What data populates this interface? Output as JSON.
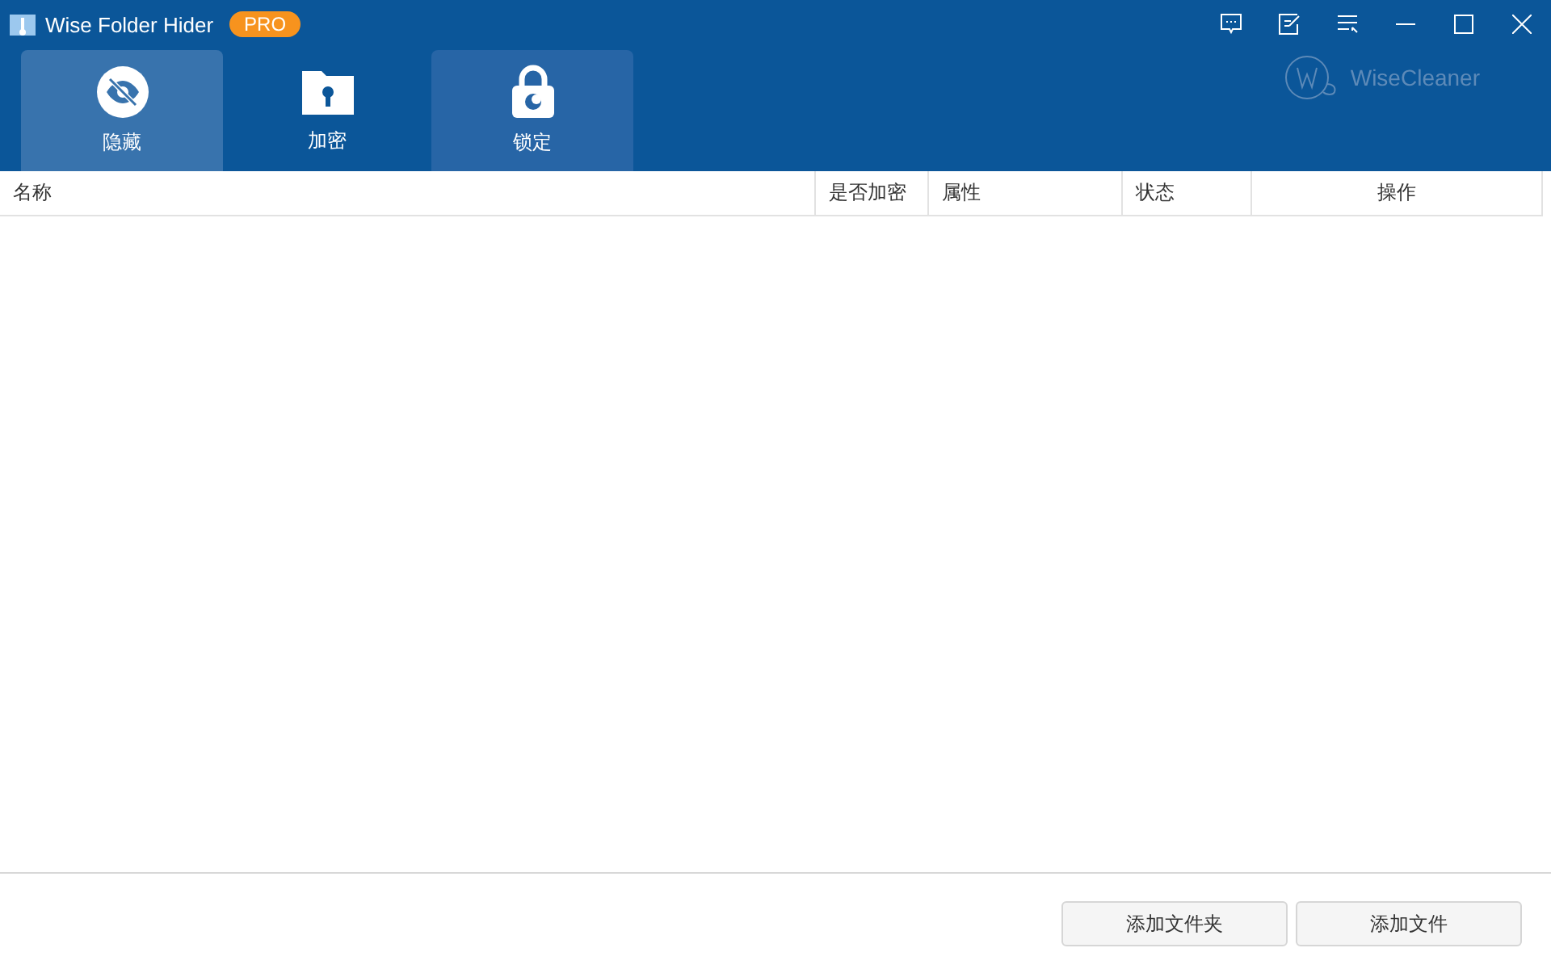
{
  "window": {
    "title": "Wise Folder Hider",
    "badge": "PRO"
  },
  "tabs": [
    {
      "label": "隐藏",
      "selected": true,
      "hovered": false
    },
    {
      "label": "加密",
      "selected": false,
      "hovered": false
    },
    {
      "label": "锁定",
      "selected": false,
      "hovered": true
    }
  ],
  "brand": "WiseCleaner",
  "table": {
    "columns": [
      {
        "label": "名称"
      },
      {
        "label": "是否加密"
      },
      {
        "label": "属性"
      },
      {
        "label": "状态"
      },
      {
        "label": "操作"
      }
    ]
  },
  "buttons": [
    "添加文件夹",
    "添加文件"
  ]
}
